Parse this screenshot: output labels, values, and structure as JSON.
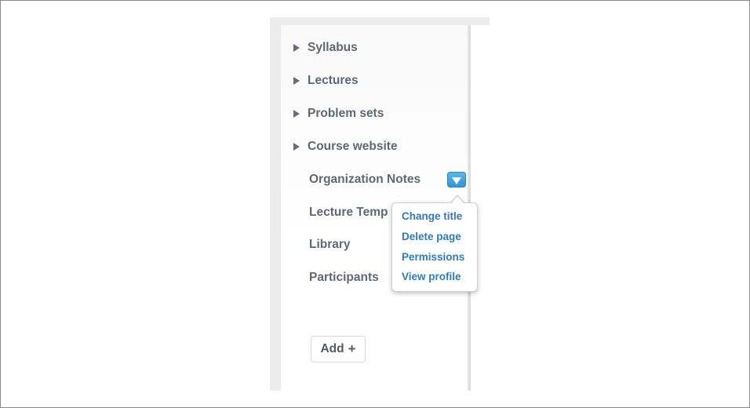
{
  "sidebar": {
    "items": [
      {
        "label": "Syllabus",
        "expandable": true
      },
      {
        "label": "Lectures",
        "expandable": true
      },
      {
        "label": "Problem sets",
        "expandable": true
      },
      {
        "label": "Course website",
        "expandable": true
      },
      {
        "label": "Organization Notes",
        "expandable": false
      },
      {
        "label": "Lecture Temp",
        "expandable": false
      },
      {
        "label": "Library",
        "expandable": false
      },
      {
        "label": "Participants",
        "expandable": false
      }
    ],
    "add_button_label": "Add",
    "add_button_icon": "+"
  },
  "context_menu": {
    "items": [
      {
        "label": "Change title"
      },
      {
        "label": "Delete page"
      },
      {
        "label": "Permissions"
      },
      {
        "label": "View profile"
      }
    ]
  },
  "colors": {
    "nav_text": "#5f6875",
    "menu_link": "#2e7bbd",
    "toggle_blue": "#3a9fe0"
  },
  "icons": {
    "expand": "caret-right-icon",
    "dropdown": "dropdown-arrow-icon",
    "add": "plus-icon"
  }
}
